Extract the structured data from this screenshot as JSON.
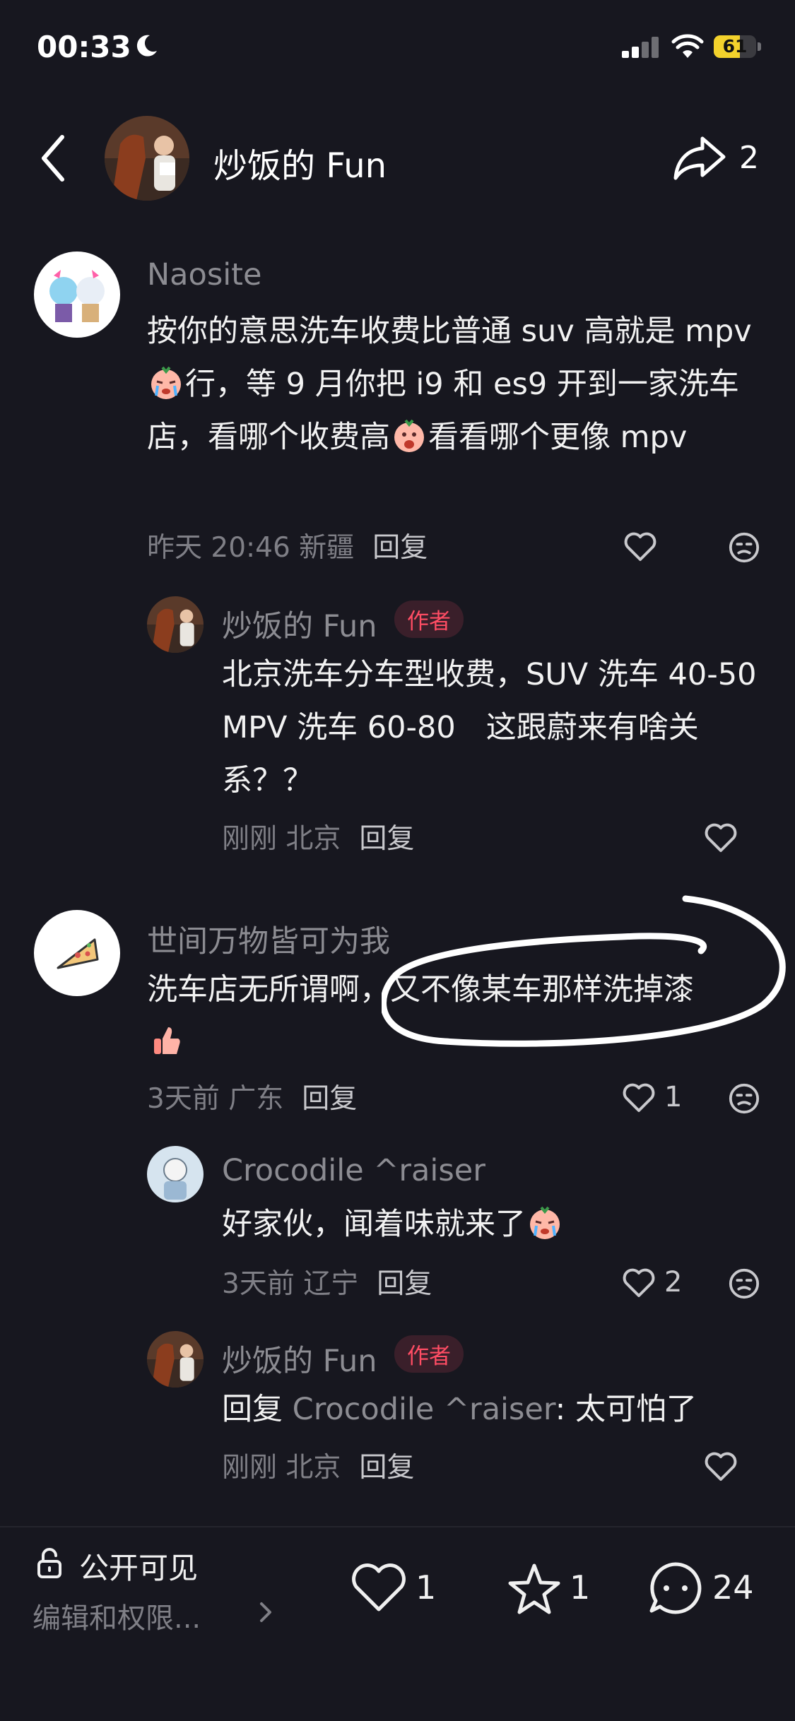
{
  "status_bar": {
    "time": "00:33",
    "battery": "61",
    "battery_level": 0.61
  },
  "header": {
    "title": "炒饭的 Fun",
    "share_count": "2"
  },
  "comments": [
    {
      "user": "Naosite",
      "text_parts": [
        "按你的意思洗车收费比普通 suv 高就是 mpv",
        "行，等 9 月你把 i9 和 es9 开到一家洗车店，看哪个收费高",
        "看看哪个更像 mpv"
      ],
      "meta": "昨天 20:46 新疆",
      "reply_label": "回复",
      "replies": [
        {
          "user": "炒饭的 Fun",
          "badge": "作者",
          "text": "北京洗车分车型收费，SUV 洗车 40-50 MPV 洗车 60-80　这跟蔚来有啥关系？？",
          "meta": "刚刚 北京",
          "reply_label": "回复"
        }
      ]
    },
    {
      "user": "世间万物皆可为我",
      "text": "洗车店无所谓啊，又不像某车那样洗掉漆",
      "meta": "3天前 广东",
      "reply_label": "回复",
      "like_count": "1",
      "replies": [
        {
          "user": "Crocodile ^raiser",
          "text": "好家伙，闻着味就来了",
          "meta": "3天前 辽宁",
          "reply_label": "回复",
          "like_count": "2"
        },
        {
          "user": "炒饭的 Fun",
          "badge": "作者",
          "text_prefix": "回复 ",
          "text_mention": "Crocodile ^raiser",
          "text_rest": ": 太可怕了",
          "meta": "刚刚 北京",
          "reply_label": "回复"
        }
      ]
    }
  ],
  "bottom_bar": {
    "visibility_label": "公开可见",
    "permission_label": "编辑和权限...",
    "like_count": "1",
    "favorite_count": "1",
    "comment_count": "24"
  },
  "colors": {
    "background": "#17171f",
    "author_badge": "#ff4d64",
    "battery": "#f3d22c"
  },
  "icons": [
    "back-chevron-icon",
    "share-icon",
    "heart-icon",
    "dislike-face-icon",
    "lock-icon",
    "star-icon",
    "comment-icon",
    "chevron-right-icon"
  ]
}
